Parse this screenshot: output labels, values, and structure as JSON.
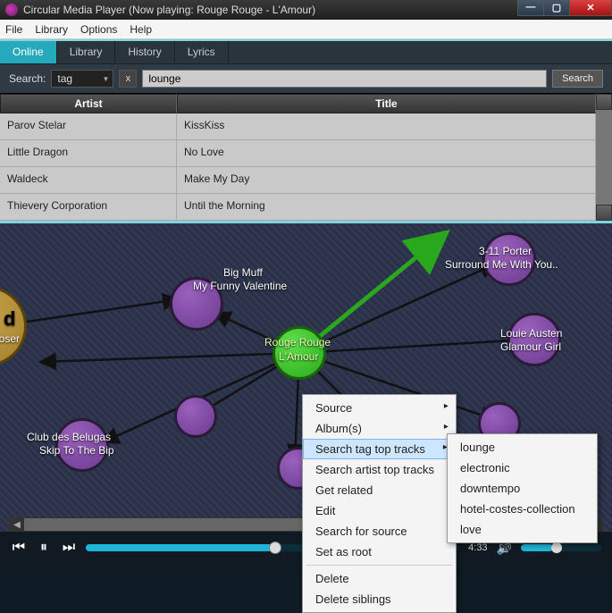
{
  "window": {
    "title": "Circular Media Player (Now playing: Rouge Rouge - L'Amour)"
  },
  "menubar": [
    "File",
    "Library",
    "Options",
    "Help"
  ],
  "tabs": [
    {
      "label": "Online",
      "active": true
    },
    {
      "label": "Library",
      "active": false
    },
    {
      "label": "History",
      "active": false
    },
    {
      "label": "Lyrics",
      "active": false
    }
  ],
  "search": {
    "label": "Search:",
    "type": "tag",
    "value": "lounge",
    "button": "Search"
  },
  "table": {
    "columns": [
      "Artist",
      "Title"
    ],
    "rows": [
      {
        "artist": "Parov Stelar",
        "title": "KissKiss"
      },
      {
        "artist": "Little Dragon",
        "title": "No Love"
      },
      {
        "artist": "Waldeck",
        "title": "Make My Day"
      },
      {
        "artist": "Thievery Corporation",
        "title": "Until the Morning"
      }
    ]
  },
  "graph": {
    "center": {
      "artist": "Rouge Rouge",
      "title": "L'Amour"
    },
    "nodes": [
      {
        "artist": "Big Muff",
        "title": "My Funny Valentine"
      },
      {
        "artist": "3-11 Porter",
        "title": "Surround Me With You.."
      },
      {
        "artist": "Louie Austen",
        "title": "Glamour Girl"
      },
      {
        "artist": "Club des Belugas",
        "title": "Skip To The Bip"
      }
    ],
    "partial": {
      "suffix": "d",
      "sub": "loser"
    }
  },
  "context_menu": {
    "items": [
      {
        "label": "Source",
        "sub": true
      },
      {
        "label": "Album(s)",
        "sub": true
      },
      {
        "label": "Search tag top tracks",
        "sub": true,
        "hover": true
      },
      {
        "label": "Search artist top tracks"
      },
      {
        "label": "Get related"
      },
      {
        "label": "Edit"
      },
      {
        "label": "Search for source"
      },
      {
        "label": "Set as root"
      },
      {
        "sep": true
      },
      {
        "label": "Delete"
      },
      {
        "label": "Delete siblings"
      }
    ],
    "submenu": [
      "lounge",
      "electronic",
      "downtempo",
      "hotel-costes-collection",
      "love"
    ]
  },
  "player": {
    "time": "4:33",
    "progress_pct": 50,
    "volume_pct": 40
  }
}
